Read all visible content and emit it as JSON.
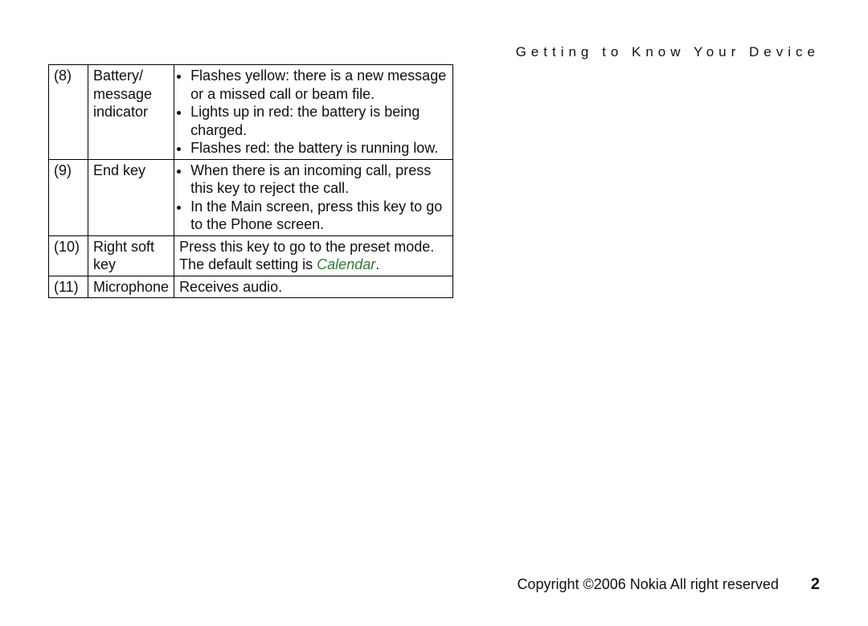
{
  "header": {
    "running_title": "Getting to Know Your Device"
  },
  "rows": [
    {
      "num": "(8)",
      "name": "Battery/ message indicator",
      "bullets": [
        "Flashes yellow: there is a new message or a missed call or beam file.",
        "Lights up in red: the battery is being charged.",
        "Flashes red: the battery is running low."
      ]
    },
    {
      "num": "(9)",
      "name": "End key",
      "bullets": [
        "When there is an incoming call, press this key to reject the call.",
        "In the Main screen, press this key to go to the Phone screen."
      ]
    },
    {
      "num": "(10)",
      "name": "Right soft key",
      "desc_prefix": "Press this key to go to the preset mode. The default setting is ",
      "desc_emph": "Calendar",
      "desc_suffix": "."
    },
    {
      "num": "(11)",
      "name": "Microphone",
      "desc_plain": "Receives audio."
    }
  ],
  "footer": {
    "copyright": "Copyright ©2006 Nokia All right reserved",
    "page_number": "2"
  }
}
